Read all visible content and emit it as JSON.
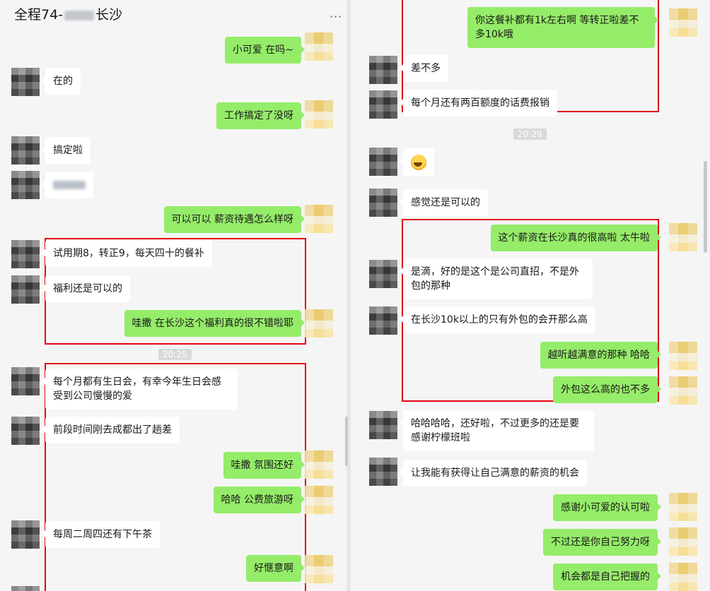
{
  "header": {
    "title_prefix": "全程74-",
    "title_suffix": "长沙",
    "more": "···"
  },
  "left": {
    "messages": [
      {
        "side": "self",
        "text": "小可爱 在吗~"
      },
      {
        "side": "other",
        "text": "在的"
      },
      {
        "side": "self",
        "text": "工作搞定了没呀"
      },
      {
        "side": "other",
        "text": "搞定啦"
      },
      {
        "side": "self",
        "text": "可以可以  薪资待遇怎么样呀"
      },
      {
        "side": "other",
        "text": "试用期8，转正9，每天四十的餐补"
      },
      {
        "side": "other",
        "text": "福利还是可以的"
      },
      {
        "side": "self",
        "text": "哇撒 在长沙这个福利真的很不错啦耶"
      },
      {
        "side": "other",
        "text": "每个月都有生日会，有幸今年生日会感受到公司慢慢的爱"
      },
      {
        "side": "other",
        "text": "前段时间刚去成都出了趟差"
      },
      {
        "side": "self",
        "text": "哇撒  氛围还好"
      },
      {
        "side": "self",
        "text": "哈哈 公费旅游呀"
      },
      {
        "side": "other",
        "text": "每周二周四还有下午茶"
      },
      {
        "side": "self",
        "text": "好惬意啊"
      }
    ],
    "time_1": "20:25"
  },
  "right": {
    "messages": [
      {
        "side": "self",
        "text": "你这餐补都有1k左右啊  等转正啦差不多10k哦"
      },
      {
        "side": "other",
        "text": "差不多"
      },
      {
        "side": "other",
        "text": "每个月还有两百额度的话费报销"
      },
      {
        "side": "other",
        "text": "感觉还是可以的"
      },
      {
        "side": "self",
        "text": "这个薪资在长沙真的很高啦  太牛啦"
      },
      {
        "side": "other",
        "text": "是滴，好的是这个是公司直招，不是外包的那种"
      },
      {
        "side": "other",
        "text": "在长沙10k以上的只有外包的会开那么高"
      },
      {
        "side": "self",
        "text": "越听越满意的那种 哈哈"
      },
      {
        "side": "self",
        "text": "外包这么高的也不多"
      },
      {
        "side": "other",
        "text": "哈哈哈哈，还好啦，不过更多的还是要感谢柠檬班啦"
      },
      {
        "side": "other",
        "text": "让我能有获得让自己满意的薪资的机会"
      },
      {
        "side": "self",
        "text": "感谢小可爱的认可啦"
      },
      {
        "side": "self",
        "text": "不过还是你自己努力呀"
      },
      {
        "side": "self",
        "text": "机会都是自己把握的"
      }
    ],
    "time_1": "20:29",
    "emoji": "grinning-tears-emoji"
  },
  "colors": {
    "self_bubble": "#95ec69",
    "other_bubble": "#ffffff",
    "highlight": "#e30613",
    "background": "#f5f5f5"
  }
}
